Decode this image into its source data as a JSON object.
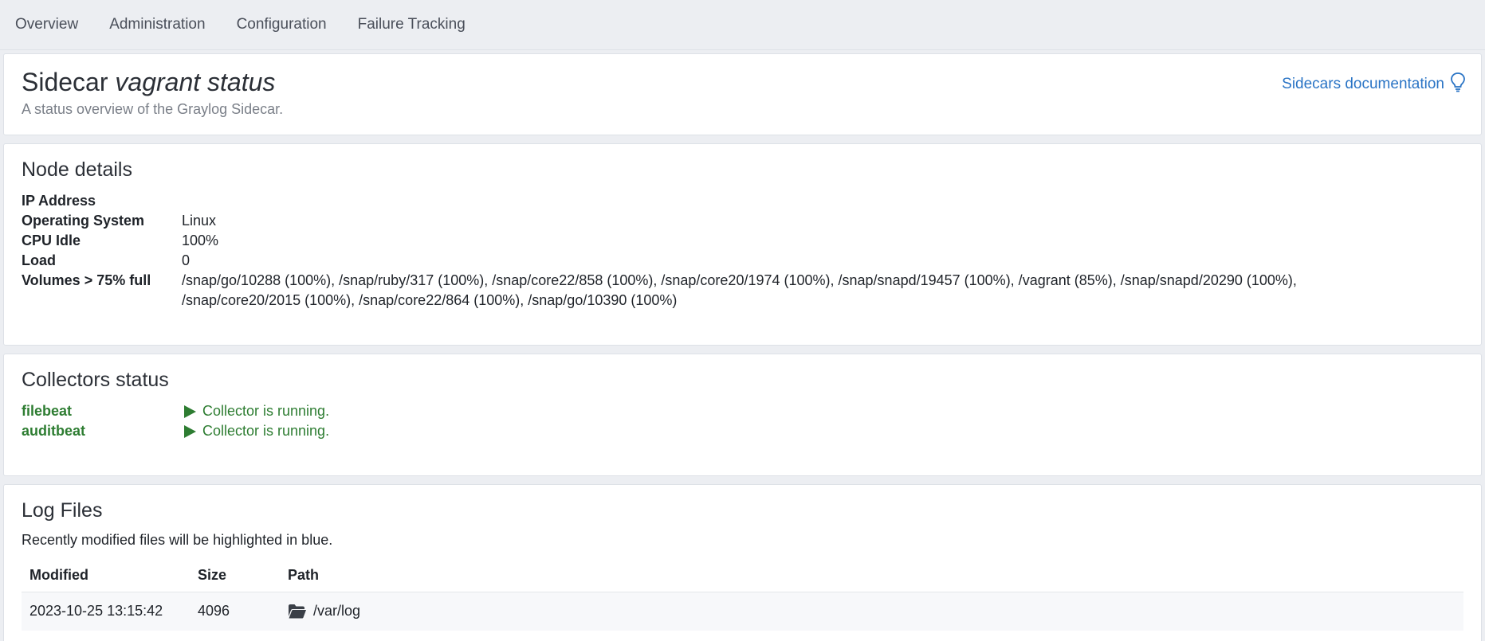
{
  "nav": {
    "items": [
      {
        "label": "Overview"
      },
      {
        "label": "Administration"
      },
      {
        "label": "Configuration"
      },
      {
        "label": "Failure Tracking"
      }
    ]
  },
  "header": {
    "title_prefix": "Sidecar",
    "title_name": "vagrant status",
    "subtitle": "A status overview of the Graylog Sidecar.",
    "doc_link": "Sidecars documentation",
    "doc_icon": "lightbulb-icon"
  },
  "node_details": {
    "title": "Node details",
    "rows": [
      {
        "label": "IP Address",
        "value": ""
      },
      {
        "label": "Operating System",
        "value": "Linux"
      },
      {
        "label": "CPU Idle",
        "value": "100%"
      },
      {
        "label": "Load",
        "value": "0"
      },
      {
        "label": "Volumes > 75% full",
        "value": "/snap/go/10288 (100%), /snap/ruby/317 (100%), /snap/core22/858 (100%), /snap/core20/1974 (100%), /snap/snapd/19457 (100%), /vagrant (85%), /snap/snapd/20290 (100%), /snap/core20/2015 (100%), /snap/core22/864 (100%), /snap/go/10390 (100%)"
      }
    ]
  },
  "collectors": {
    "title": "Collectors status",
    "items": [
      {
        "name": "filebeat",
        "status": "Collector is running."
      },
      {
        "name": "auditbeat",
        "status": "Collector is running."
      }
    ],
    "status_color": "#2e7d32"
  },
  "log_files": {
    "title": "Log Files",
    "description": "Recently modified files will be highlighted in blue.",
    "columns": [
      "Modified",
      "Size",
      "Path"
    ],
    "rows": [
      {
        "modified": "2023-10-25 13:15:42",
        "size": "4096",
        "path": "/var/log",
        "icon": "folder-open-icon"
      }
    ]
  },
  "colors": {
    "link": "#2a74c5",
    "background": "#eceef2"
  }
}
